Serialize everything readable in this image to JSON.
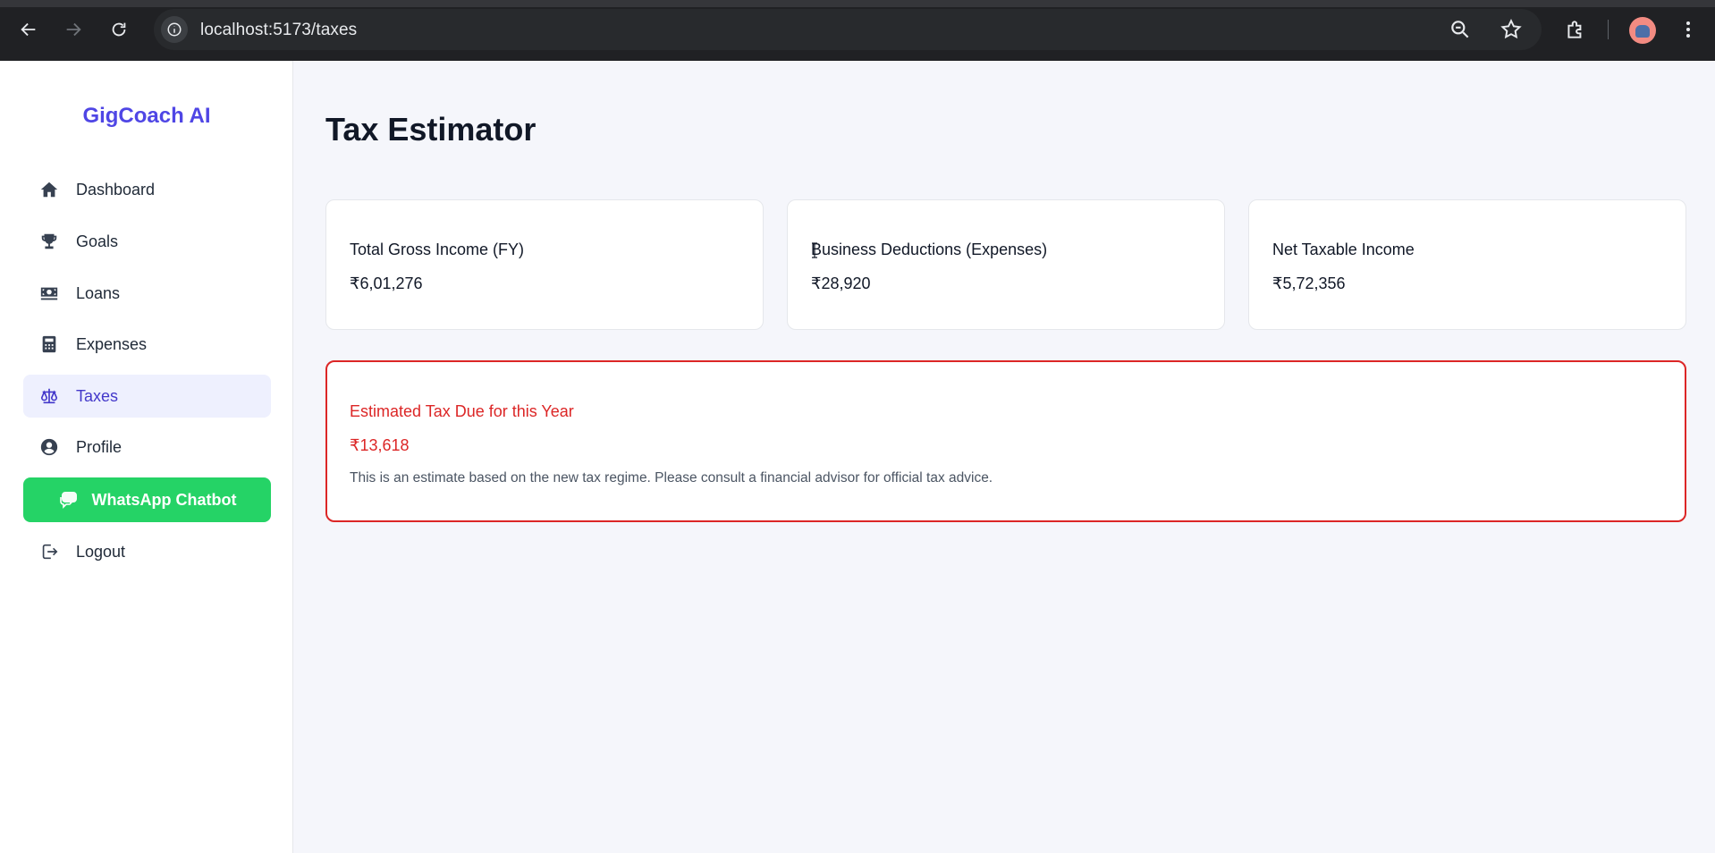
{
  "browser": {
    "url": "localhost:5173/taxes",
    "icons": [
      "back-arrow-icon",
      "forward-arrow-icon",
      "reload-icon",
      "site-info-icon",
      "zoom-icon",
      "bookmark-star-icon",
      "extensions-icon",
      "profile-avatar",
      "more-menu-icon"
    ]
  },
  "sidebar": {
    "brand": "GigCoach AI",
    "items": [
      {
        "label": "Dashboard",
        "icon": "home-icon"
      },
      {
        "label": "Goals",
        "icon": "trophy-icon"
      },
      {
        "label": "Loans",
        "icon": "money-icon"
      },
      {
        "label": "Expenses",
        "icon": "calculator-icon"
      },
      {
        "label": "Taxes",
        "icon": "scale-icon",
        "active": true
      },
      {
        "label": "Profile",
        "icon": "user-circle-icon"
      }
    ],
    "whatsapp_label": "WhatsApp Chatbot",
    "logout_label": "Logout"
  },
  "main": {
    "title": "Tax Estimator",
    "cards": [
      {
        "label": "Total Gross Income (FY)",
        "value": "₹6,01,276"
      },
      {
        "label": "Business Deductions (Expenses)",
        "value": "₹28,920"
      },
      {
        "label": "Net Taxable Income",
        "value": "₹5,72,356"
      }
    ],
    "tax_due": {
      "label": "Estimated Tax Due for this Year",
      "value": "₹13,618",
      "note": "This is an estimate based on the new tax regime. Please consult a financial advisor for official tax advice."
    }
  },
  "colors": {
    "brand": "#4f46e5",
    "active_bg": "#eef0fe",
    "whatsapp": "#25d366",
    "danger": "#dc2626"
  }
}
